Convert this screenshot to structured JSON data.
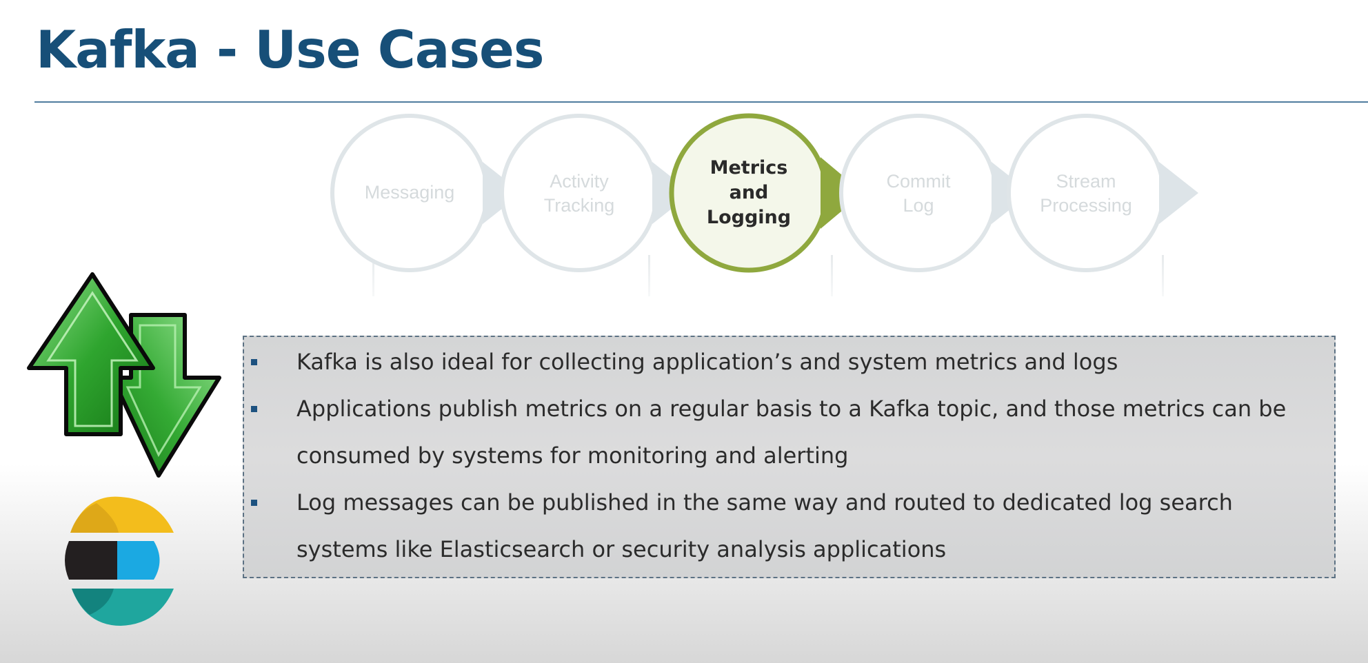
{
  "slide": {
    "title": "Kafka - Use Cases"
  },
  "steps": [
    {
      "lines": [
        "Messaging"
      ],
      "active": false
    },
    {
      "lines": [
        "Activity",
        "Tracking"
      ],
      "active": false
    },
    {
      "lines": [
        "Metrics",
        "and",
        "Logging"
      ],
      "active": true
    },
    {
      "lines": [
        "Commit",
        "Log"
      ],
      "active": false
    },
    {
      "lines": [
        "Stream",
        "Processing"
      ],
      "active": false
    }
  ],
  "colors": {
    "title": "#174f78",
    "active_step_ring": "#8fa83e",
    "active_step_fill": "#f4f7ea",
    "inactive_step": "#dde4e8",
    "arrow_green": "#2fa52f",
    "bullet_marker": "#1d5280"
  },
  "icons": [
    "transfer-arrows-icon",
    "elasticsearch-logo"
  ],
  "bullets": [
    "Kafka is also ideal for collecting application’s and system metrics and logs",
    "Applications publish metrics on a regular basis to a Kafka topic, and those metrics can be consumed by systems for monitoring and alerting",
    "Log messages can be published in the same way and routed to dedicated log search systems like Elasticsearch or security analysis applications"
  ]
}
